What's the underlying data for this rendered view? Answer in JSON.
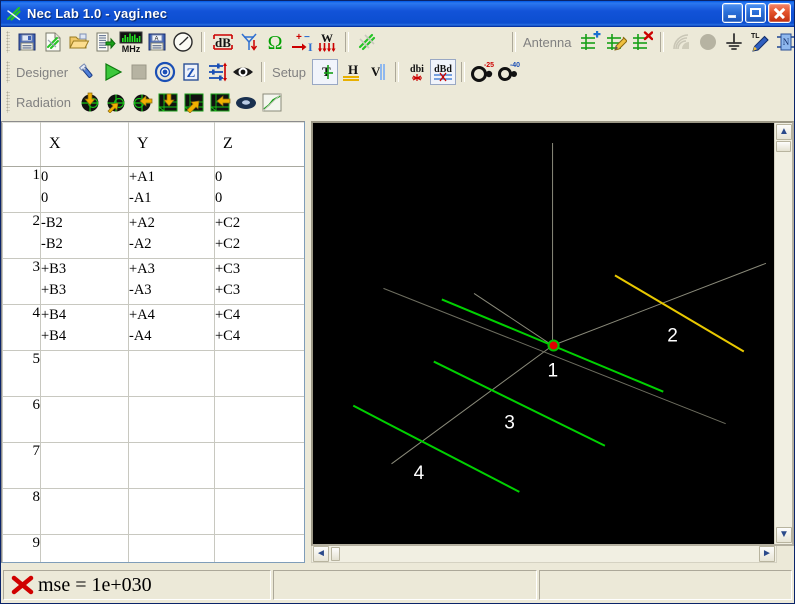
{
  "window": {
    "title": "Nec Lab 1.0 - yagi.nec",
    "app_icon": "nec-lab-icon",
    "minimize_label": "Minimize",
    "maximize_label": "Maximize",
    "close_label": "Close"
  },
  "toolbars": {
    "row1": [
      {
        "name": "save-file-button",
        "icon": "floppy-disk-icon"
      },
      {
        "name": "new-file-button",
        "icon": "new-document-icon"
      },
      {
        "name": "open-file-button",
        "icon": "open-folder-icon"
      },
      {
        "name": "export-file-button",
        "icon": "export-list-icon"
      },
      {
        "name": "frequency-button",
        "icon": "mhz-meter-icon",
        "label": "MHz"
      },
      {
        "name": "save-as-button",
        "icon": "floppy-disk-a-icon"
      },
      {
        "name": "meter-button",
        "icon": "gauge-icon"
      },
      {
        "name": "gain-db-button",
        "icon": "db-icon",
        "label": "dB"
      },
      {
        "name": "antenna-chart-button",
        "icon": "antenna-signal-icon"
      },
      {
        "name": "impedance-button",
        "icon": "omega-icon"
      },
      {
        "name": "current-button",
        "icon": "plus-minus-current-icon"
      },
      {
        "name": "power-button",
        "icon": "watt-icon"
      },
      {
        "name": "wires-button",
        "icon": "wires-icon"
      }
    ],
    "row1_right": {
      "label": "Antenna",
      "buttons": [
        {
          "name": "add-antenna-button",
          "icon": "add-antenna-icon"
        },
        {
          "name": "edit-antenna-button",
          "icon": "edit-antenna-icon"
        },
        {
          "name": "delete-antenna-button",
          "icon": "delete-antenna-icon"
        },
        {
          "name": "ground-wave-button",
          "icon": "radio-waves-icon"
        },
        {
          "name": "sphere-button",
          "icon": "sphere-icon"
        },
        {
          "name": "ground-button",
          "icon": "ground-symbol-icon"
        },
        {
          "name": "transmission-line-button",
          "icon": "tl-pencil-icon"
        },
        {
          "name": "network-button",
          "icon": "network-block-icon"
        }
      ]
    },
    "row2": {
      "label": "Designer",
      "buttons": [
        {
          "name": "tools-button",
          "icon": "wrench-icon"
        },
        {
          "name": "run-button",
          "icon": "play-icon"
        },
        {
          "name": "stop-button",
          "icon": "stop-icon"
        },
        {
          "name": "target-button",
          "icon": "target-icon"
        },
        {
          "name": "impedance-z-button",
          "icon": "z-box-icon"
        },
        {
          "name": "optimize-button",
          "icon": "sliders-icon"
        },
        {
          "name": "view-button",
          "icon": "eye-icon"
        }
      ]
    },
    "row2_setup": {
      "label": "Setup",
      "buttons": [
        {
          "name": "total-field-button",
          "icon": "t-polarization-icon",
          "label": "T",
          "active": true
        },
        {
          "name": "horizontal-field-button",
          "icon": "h-polarization-icon",
          "label": "H"
        },
        {
          "name": "vertical-field-button",
          "icon": "v-polarization-icon",
          "label": "V"
        }
      ]
    },
    "row2_units": [
      {
        "name": "dbi-button",
        "icon": "dbi-icon",
        "label": "dbi"
      },
      {
        "name": "dbd-button",
        "icon": "dbd-icon",
        "label": "dBd",
        "active": true
      },
      {
        "name": "pattern-25-button",
        "icon": "pattern-scale-icon",
        "label": "-25"
      },
      {
        "name": "pattern-40-button",
        "icon": "pattern-scale-icon",
        "label": "-40"
      }
    ],
    "row3": {
      "label": "Radiation",
      "buttons": [
        {
          "name": "pattern-down-button",
          "icon": "pattern-arrow-down-icon"
        },
        {
          "name": "pattern-up-button",
          "icon": "pattern-arrow-up-icon"
        },
        {
          "name": "pattern-left-button",
          "icon": "pattern-arrow-left-icon"
        },
        {
          "name": "plot-down-button",
          "icon": "plot-arrow-down-icon"
        },
        {
          "name": "plot-up-button",
          "icon": "plot-arrow-up-icon"
        },
        {
          "name": "plot-left-button",
          "icon": "plot-arrow-left-icon"
        },
        {
          "name": "torus-3d-button",
          "icon": "torus-icon"
        },
        {
          "name": "graph-button",
          "icon": "line-graph-icon"
        }
      ]
    }
  },
  "table": {
    "headers": [
      "",
      "X",
      "Y",
      "Z"
    ],
    "rows": [
      {
        "num": "1",
        "x": [
          "0",
          "0"
        ],
        "y": [
          "+A1",
          "-A1"
        ],
        "z": [
          "0",
          "0"
        ]
      },
      {
        "num": "2",
        "x": [
          "-B2",
          "-B2"
        ],
        "y": [
          "+A2",
          "-A2"
        ],
        "z": [
          "+C2",
          "+C2"
        ]
      },
      {
        "num": "3",
        "x": [
          "+B3",
          "+B3"
        ],
        "y": [
          "+A3",
          "-A3"
        ],
        "z": [
          "+C3",
          "+C3"
        ]
      },
      {
        "num": "4",
        "x": [
          "+B4",
          "+B4"
        ],
        "y": [
          "+A4",
          "-A4"
        ],
        "z": [
          "+C4",
          "+C4"
        ]
      },
      {
        "num": "5",
        "x": [
          "",
          ""
        ],
        "y": [
          "",
          ""
        ],
        "z": [
          "",
          ""
        ]
      },
      {
        "num": "6",
        "x": [
          "",
          ""
        ],
        "y": [
          "",
          ""
        ],
        "z": [
          "",
          ""
        ]
      },
      {
        "num": "7",
        "x": [
          "",
          ""
        ],
        "y": [
          "",
          ""
        ],
        "z": [
          "",
          ""
        ]
      },
      {
        "num": "8",
        "x": [
          "",
          ""
        ],
        "y": [
          "",
          ""
        ],
        "z": [
          "",
          ""
        ]
      },
      {
        "num": "9",
        "x": [
          "",
          ""
        ],
        "y": [
          "",
          ""
        ],
        "z": [
          "",
          ""
        ]
      }
    ]
  },
  "viewport": {
    "background": "#000000",
    "axis_color": "#8a8a7a",
    "wire_color": "#00d000",
    "selected_wire_color": "#e8c800",
    "feed_point_color": "#e00000",
    "label_color": "#ffffff",
    "wire_labels": [
      "1",
      "2",
      "3",
      "4"
    ]
  },
  "scrollbars": {
    "vertical_up": "▲",
    "vertical_down": "▼",
    "horizontal_left": "◄",
    "horizontal_right": "►"
  },
  "status": {
    "icon": "red-x-icon",
    "message": "mse = 1e+030",
    "panel2": "",
    "panel3": ""
  }
}
